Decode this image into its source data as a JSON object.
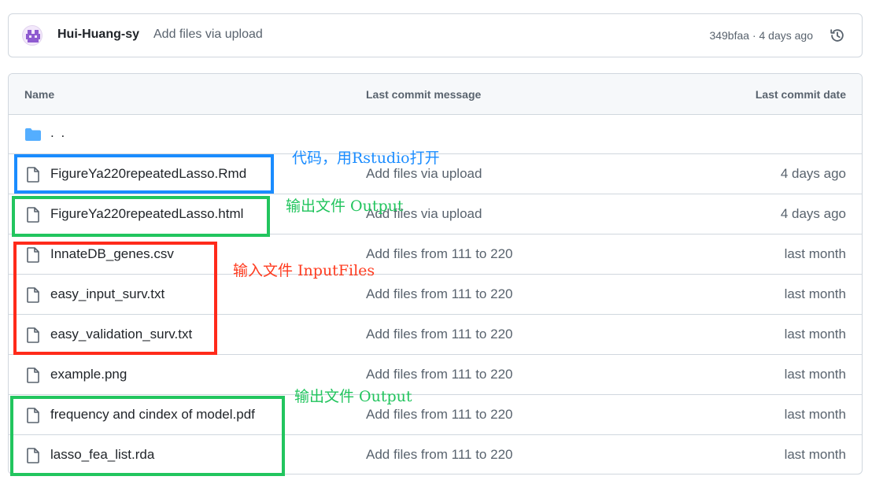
{
  "commit": {
    "author": "Hui-Huang-sy",
    "message": "Add files via upload",
    "meta": "349bfaa · 4 days ago"
  },
  "table": {
    "headers": {
      "name": "Name",
      "message": "Last commit message",
      "date": "Last commit date"
    },
    "parent": ". ."
  },
  "files": [
    {
      "name": "FigureYa220repeatedLasso.Rmd",
      "message": "Add files via upload",
      "date": "4 days ago"
    },
    {
      "name": "FigureYa220repeatedLasso.html",
      "message": "Add files via upload",
      "date": "4 days ago"
    },
    {
      "name": "InnateDB_genes.csv",
      "message": "Add files from 111 to 220",
      "date": "last month"
    },
    {
      "name": "easy_input_surv.txt",
      "message": "Add files from 111 to 220",
      "date": "last month"
    },
    {
      "name": "easy_validation_surv.txt",
      "message": "Add files from 111 to 220",
      "date": "last month"
    },
    {
      "name": "example.png",
      "message": "Add files from 111 to 220",
      "date": "last month"
    },
    {
      "name": "frequency and cindex of model.pdf",
      "message": "Add files from 111 to 220",
      "date": "last month"
    },
    {
      "name": "lasso_fea_list.rda",
      "message": "Add files from 111 to 220",
      "date": "last month"
    }
  ],
  "annotations": {
    "code": "代码，用Rstudio打开",
    "output1": "输出文件 Output",
    "input": "输入文件 InputFiles",
    "output2": "输出文件 Output"
  },
  "colors": {
    "blue_box": "#1a8cff",
    "green_box": "#22c55e",
    "red_box": "#ff2a1a",
    "folder": "#54aeff",
    "code_text": "#1a8cff",
    "output_text": "#21c45d",
    "input_text": "#ff3b1f"
  }
}
